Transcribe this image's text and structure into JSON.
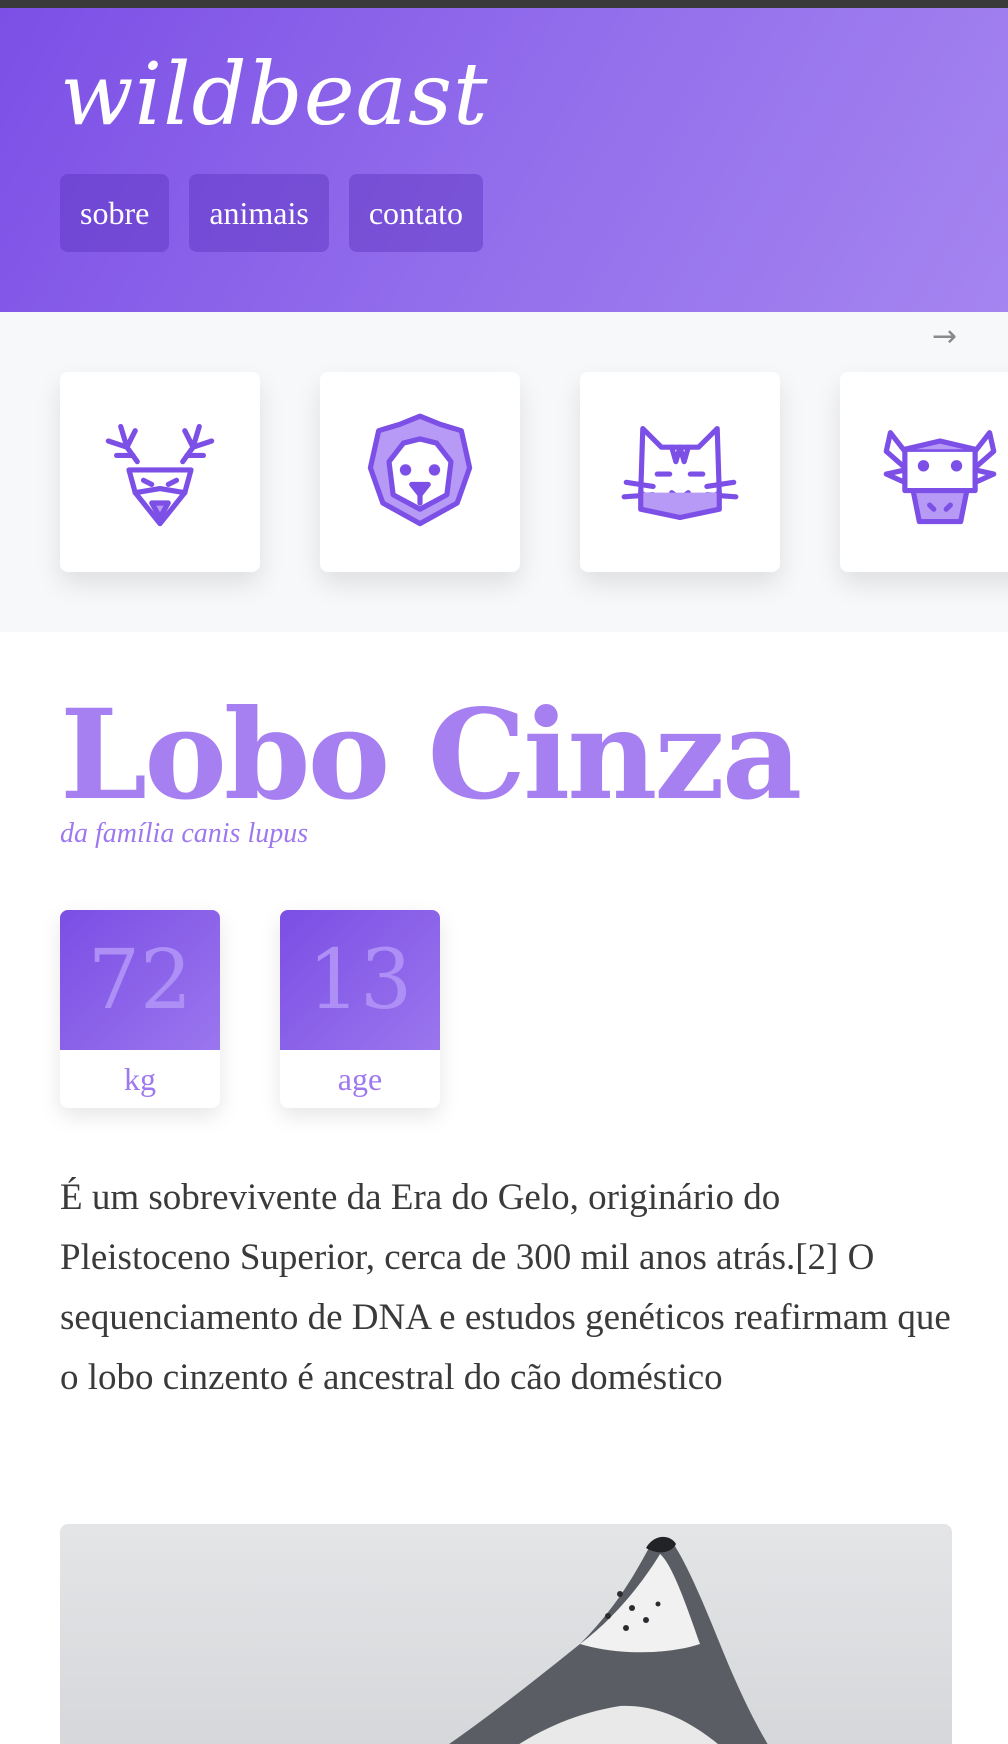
{
  "site": {
    "logo": "wildbeast"
  },
  "nav": {
    "items": [
      {
        "label": "sobre"
      },
      {
        "label": "animais"
      },
      {
        "label": "contato"
      }
    ]
  },
  "carousel": {
    "next_arrow": "→",
    "animals": [
      {
        "icon": "deer-icon"
      },
      {
        "icon": "lion-icon"
      },
      {
        "icon": "cat-icon"
      },
      {
        "icon": "bull-icon"
      }
    ]
  },
  "animal": {
    "name": "Lobo Cinza",
    "family": "da família canis lupus",
    "stats": [
      {
        "value": "72",
        "unit": "kg"
      },
      {
        "value": "13",
        "unit": "age"
      }
    ],
    "description": "É um sobrevivente da Era do Gelo, originário do Pleistoceno Superior, cerca de 300 mil anos atrás.[2] O sequenciamento de DNA e estudos genéticos reafirmam que o lobo cinzento é ancestral do cão doméstico"
  },
  "colors": {
    "accent": "#7c4fe6",
    "accent_light": "#a67ff1",
    "text": "#3a3a3a"
  }
}
